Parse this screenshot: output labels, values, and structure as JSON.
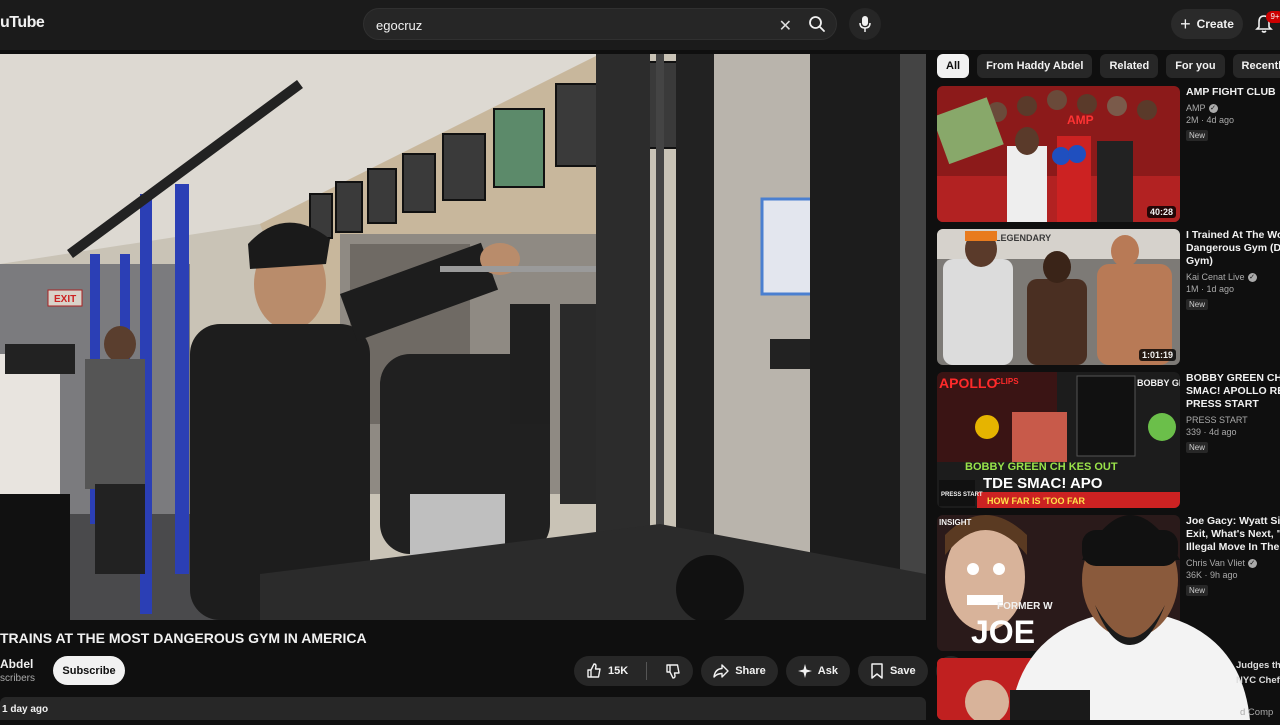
{
  "header": {
    "logo_text": "uTube",
    "search_value": "egocruz",
    "create_label": "Create",
    "notif_count": "9+"
  },
  "video": {
    "title": "TRAINS AT THE MOST DANGEROUS GYM IN AMERICA",
    "channel": "Abdel",
    "subscribers": "scribers",
    "subscribe_label": "Subscribe",
    "likes": "15K",
    "share_label": "Share",
    "ask_label": "Ask",
    "save_label": "Save",
    "posted": "1 day ago"
  },
  "chips": [
    "All",
    "From Haddy Abdel",
    "Related",
    "For you",
    "Recently uploa"
  ],
  "recommendations": [
    {
      "title_lines": [
        "AMP FIGHT CLUB"
      ],
      "channel": "AMP",
      "verified": true,
      "stats": "2M · 4d ago",
      "badge": "New",
      "duration": "40:28"
    },
    {
      "title_lines": [
        "I Trained At The Wor",
        "Dangerous Gym (Di",
        "Gym)"
      ],
      "channel": "Kai Cenat Live",
      "verified": true,
      "stats": "1M · 1d ago",
      "badge": "New",
      "duration": "1:01:19"
    },
    {
      "title_lines": [
        "BOBBY GREEN CH*",
        "SMAC! APOLLO REA",
        "PRESS START"
      ],
      "channel": "PRESS START",
      "verified": false,
      "stats": "339 · 4d ago",
      "badge": "New",
      "duration": ""
    },
    {
      "title_lines": [
        "Joe Gacy: Wyatt Sic",
        "Exit, What's Next, \"T",
        "Illegal Move In The I"
      ],
      "channel": "Chris Van Vliet",
      "verified": true,
      "stats": "36K · 9h ago",
      "badge": "New",
      "duration": ""
    }
  ],
  "partial_texts": [
    "Judges th",
    "NYC Chef",
    "d Comp"
  ],
  "thumb_texts": {
    "legendary": "LEGENDARY",
    "apollo": "APOLLO",
    "clips": "CLIPS",
    "bobby_green": "BOBBY GREEN",
    "bobby_green_chikes": "BOBBY GREEN CH KES OUT",
    "tde_smac": "TDE SMAC! APO",
    "how_far": "HOW FAR IS 'TOO FAR",
    "press_start": "PRESS START",
    "insight": "INSIGHT",
    "former": "FORMER W",
    "joe": "JOE",
    "exit_sign": "EXIT",
    "amp": "AMP"
  }
}
